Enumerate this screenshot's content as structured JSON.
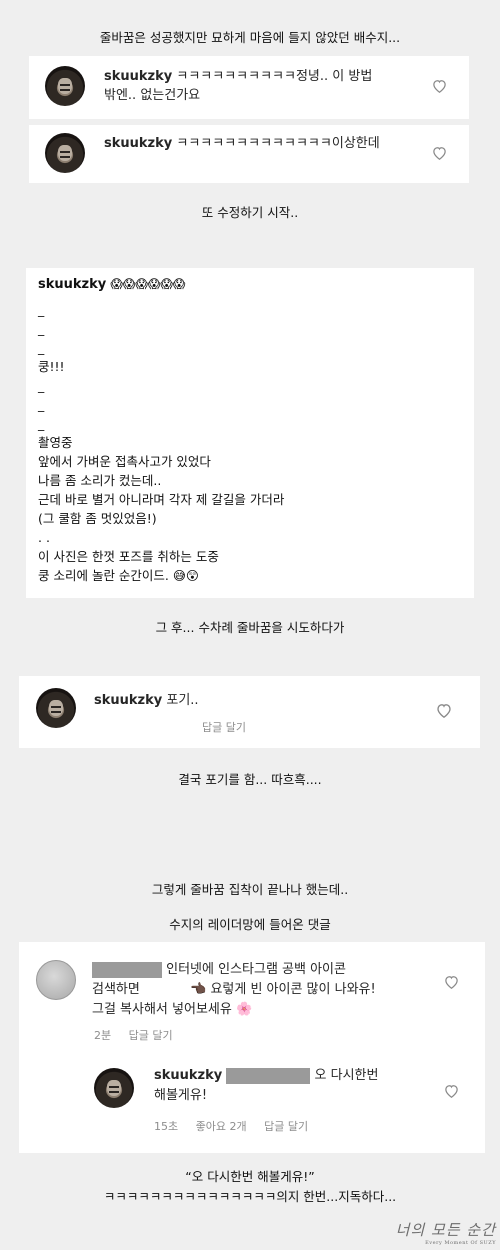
{
  "captions": {
    "c1": "줄바꿈은 성공했지만 묘하게 마음에 들지 않았던 배수지...",
    "c2": "또 수정하기 시작..",
    "c3": "그 후... 수차례 줄바꿈을 시도하다가",
    "c4": "결국 포기를 함... 따흐흑....",
    "c5": "그렇게 줄바꿈 집착이 끝나나 했는데..",
    "c6": "수지의 레이더망에 들어온 댓글",
    "c7_line1": "“오 다시한번 해볼게유!”",
    "c7_line2": "ㅋㅋㅋㅋㅋㅋㅋㅋㅋㅋㅋㅋㅋㅋㅋ의지 한번...지독하다..."
  },
  "comment1": {
    "username": "skuukzky",
    "text_line1": "ㅋㅋㅋㅋㅋㅋㅋㅋㅋㅋ정녕.. 이 방법",
    "text_line2": "밖엔.. 없는건가요"
  },
  "comment2": {
    "username": "skuukzky",
    "text": "ㅋㅋㅋㅋㅋㅋㅋㅋㅋㅋㅋㅋㅋ이상한데"
  },
  "post": {
    "username": "skuukzky",
    "emojis": "😱😱😱😱😱😱",
    "lines": [
      "_",
      "_",
      "_",
      "쿵!!!",
      "_",
      "_",
      "_",
      "촬영중",
      "앞에서 가벼운 접촉사고가 있었다",
      "나름 좀 소리가 컸는데..",
      "근데 바로 별거 아니라며 각자 제 갈길을 가더라",
      "(그 쿨함 좀 멋있었음!)",
      ". .",
      "이 사진은 한껏 포즈를 취하는 도중",
      "쿵 소리에 놀란 순간이드. 😅😲"
    ]
  },
  "comment3": {
    "username": "skuukzky",
    "text": "포기..",
    "reply_label": "답글 달기"
  },
  "thread": {
    "c1_line1": "인터넷에 인스타그램 공백 아이콘",
    "c1_line2a": "검색하면",
    "c1_line2b": "👈🏿 요렇게 빈 아이콘 많이 나와유!",
    "c1_line3": "그걸 복사해서 넣어보세유 🌸",
    "c1_time": "2분",
    "c1_reply": "답글 달기",
    "reply_username": "skuukzky",
    "reply_text_a": "오 다시한번",
    "reply_text_b": "해볼게유!",
    "reply_time": "15초",
    "reply_likes": "좋아요 2개",
    "reply_reply": "답글 달기"
  },
  "watermark": {
    "big": "너의 모든 순간",
    "small": "Every Moment Of SUZY"
  },
  "icons": [
    "heart-outline-icon"
  ]
}
